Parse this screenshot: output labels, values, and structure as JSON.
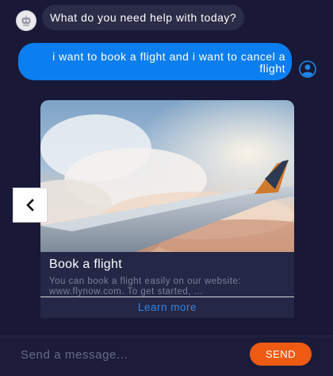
{
  "messages": {
    "bot_greeting": "What do you need help with today?",
    "user_message": "i want to book a flight and i want to cancel a flight"
  },
  "card": {
    "title": "Book a flight",
    "description": "You can book a flight easily on our website: www.flynow.com. To get started, ...",
    "link_label": "Learn more"
  },
  "composer": {
    "placeholder": "Send a message...",
    "send_label": "SEND"
  },
  "colors": {
    "background": "#191937",
    "bot_bubble": "#2b2c47",
    "user_bubble": "#0b7ef0",
    "link": "#2f86e8",
    "send_button": "#ef5a12"
  },
  "icons": {
    "bot_avatar": "robot-avatar-icon",
    "user_avatar": "user-avatar-icon",
    "carousel_prev": "chevron-left-icon"
  }
}
